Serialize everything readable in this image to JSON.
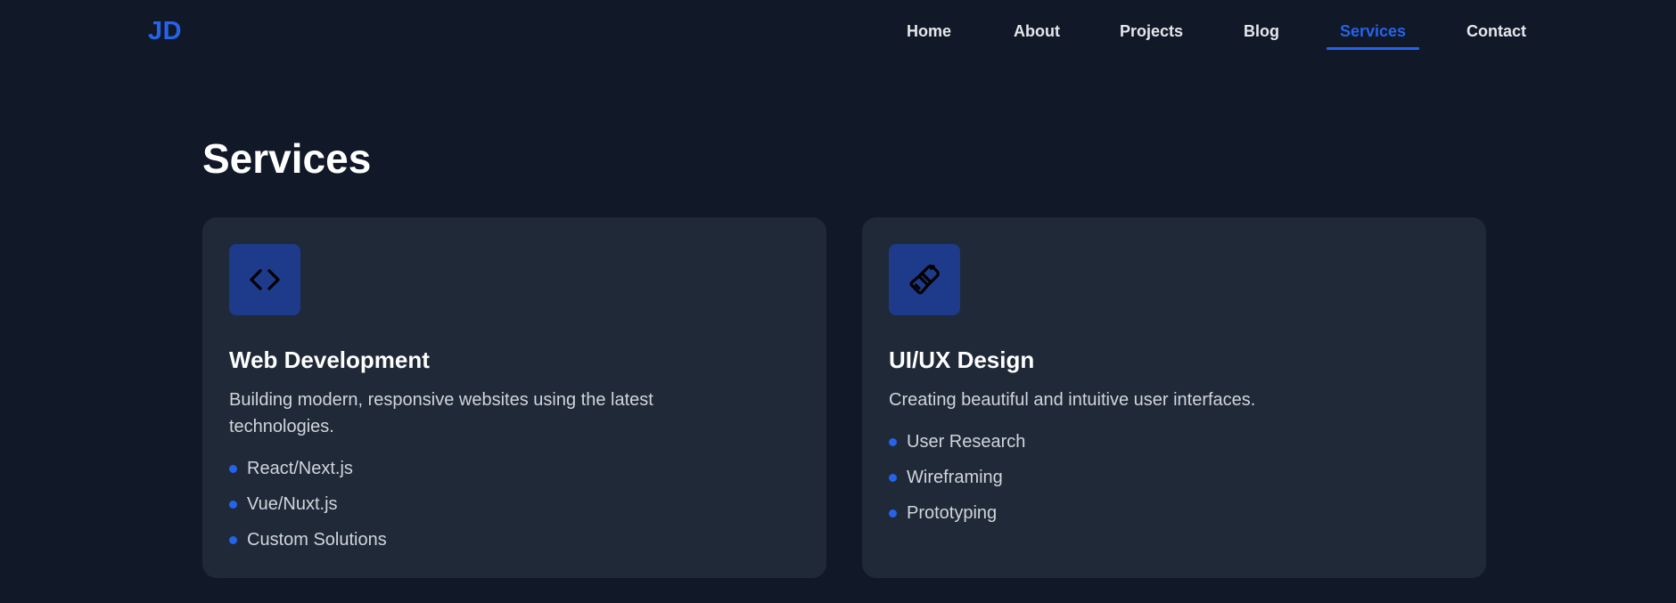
{
  "header": {
    "logo": "JD",
    "nav": [
      {
        "label": "Home",
        "active": false
      },
      {
        "label": "About",
        "active": false
      },
      {
        "label": "Projects",
        "active": false
      },
      {
        "label": "Blog",
        "active": false
      },
      {
        "label": "Services",
        "active": true
      },
      {
        "label": "Contact",
        "active": false
      }
    ]
  },
  "main": {
    "title": "Services",
    "cards": [
      {
        "icon": "code-icon",
        "title": "Web Development",
        "description": "Building modern, responsive websites using the latest technologies.",
        "features": [
          "React/Next.js",
          "Vue/Nuxt.js",
          "Custom Solutions"
        ]
      },
      {
        "icon": "paintbrush-icon",
        "title": "UI/UX Design",
        "description": "Creating beautiful and intuitive user interfaces.",
        "features": [
          "User Research",
          "Wireframing",
          "Prototyping"
        ]
      }
    ]
  },
  "colors": {
    "background": "#111827",
    "card": "#1f2937",
    "accent": "#2563eb",
    "icon_box": "#1e3a8a"
  }
}
